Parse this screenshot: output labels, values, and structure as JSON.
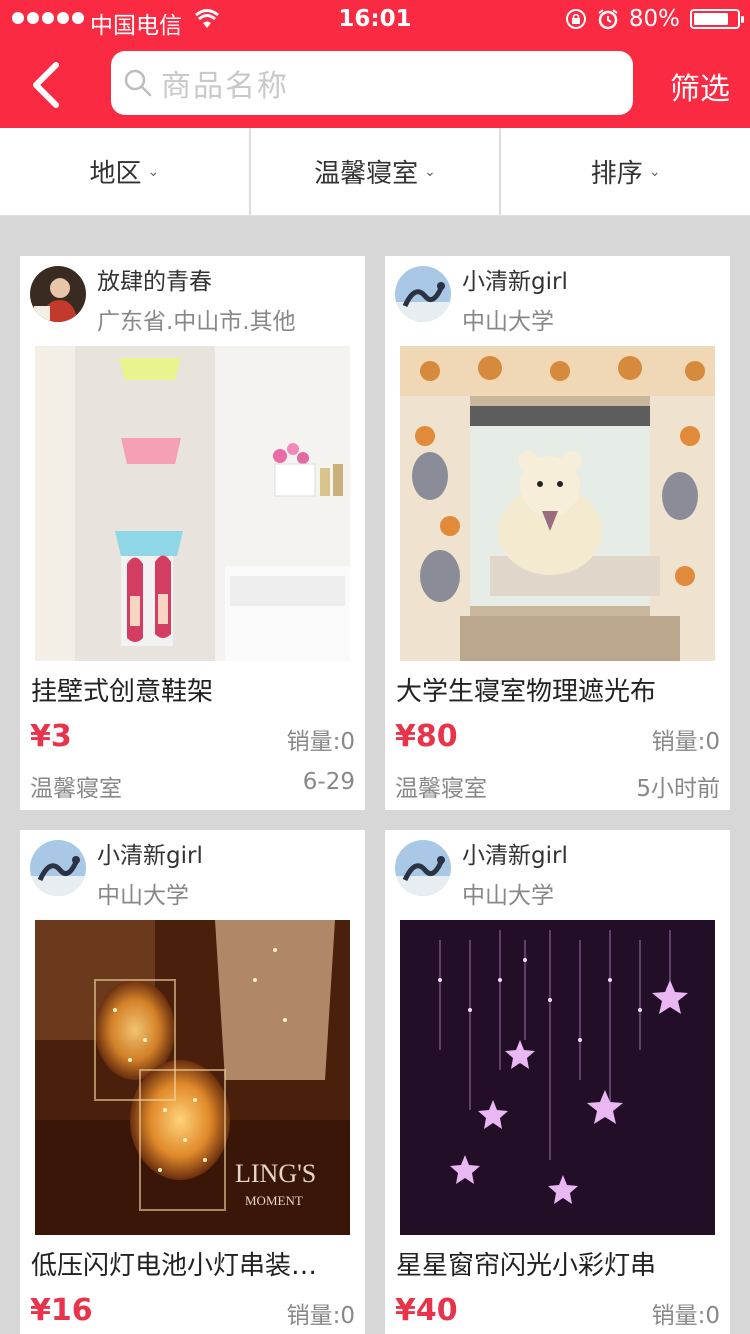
{
  "status": {
    "carrier": "中国电信",
    "time": "16:01",
    "battery": "80%",
    "battery_level": 0.8
  },
  "header": {
    "search_placeholder": "商品名称",
    "filter_label": "筛选"
  },
  "tabs": [
    {
      "label": "地区"
    },
    {
      "label": "温馨寝室"
    },
    {
      "label": "排序"
    }
  ],
  "products": [
    {
      "user": "放肆的青春",
      "location": "广东省.中山市.其他",
      "title": "挂壁式创意鞋架",
      "price": "¥3",
      "sales": "销量:0",
      "category": "温馨寝室",
      "date": "6-29"
    },
    {
      "user": "小清新girl",
      "location": "中山大学",
      "title": "大学生寝室物理遮光布",
      "price": "¥80",
      "sales": "销量:0",
      "category": "温馨寝室",
      "date": "5小时前"
    },
    {
      "user": "小清新girl",
      "location": "中山大学",
      "title": "低压闪灯电池小灯串装…",
      "price": "¥16",
      "sales": "销量:0",
      "category": "",
      "date": ""
    },
    {
      "user": "小清新girl",
      "location": "中山大学",
      "title": "星星窗帘闪光小彩灯串",
      "price": "¥40",
      "sales": "销量:0",
      "category": "",
      "date": ""
    }
  ],
  "photo_watermark": {
    "line1": "LING'S",
    "line2": "MOMENT"
  }
}
